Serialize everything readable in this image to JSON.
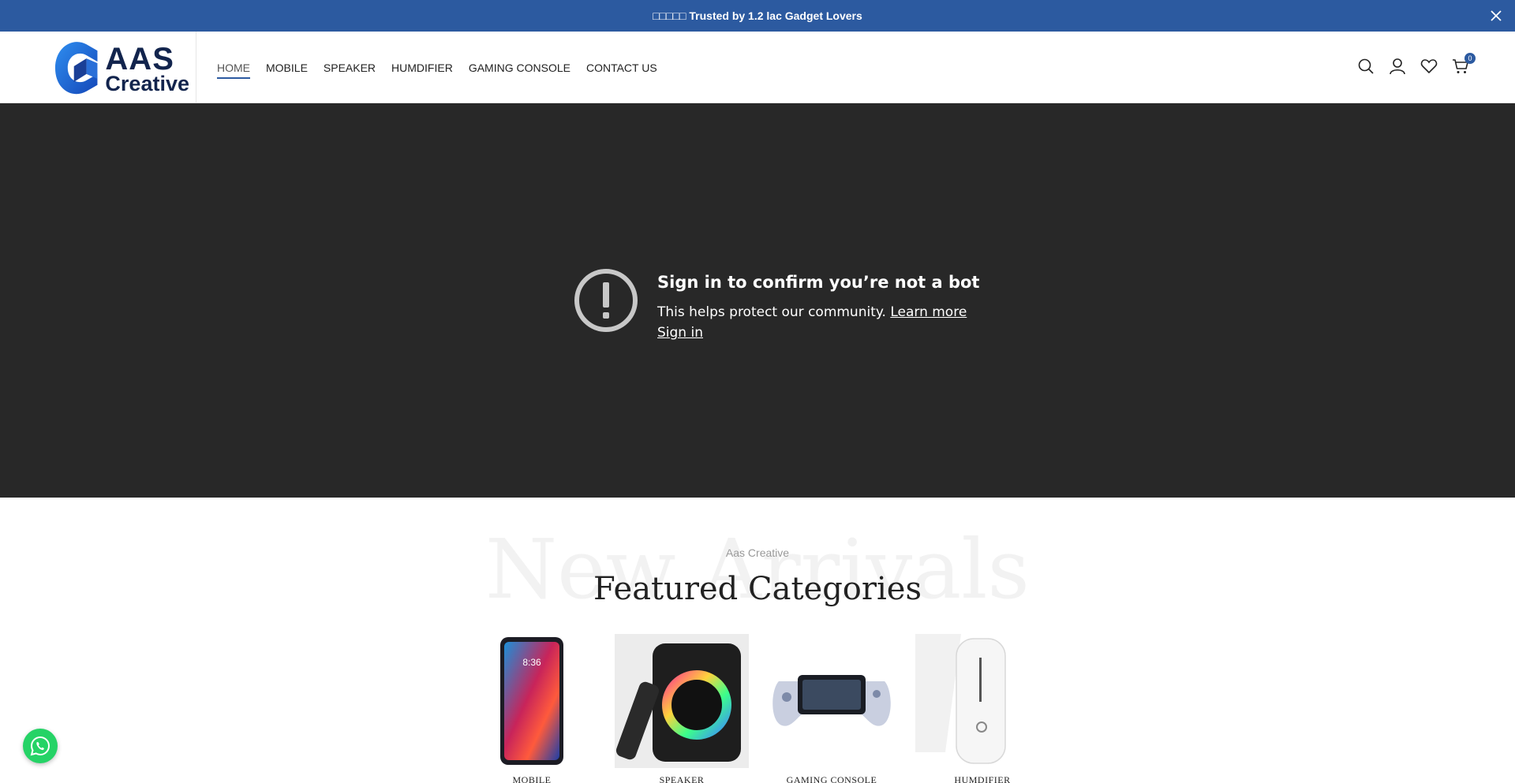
{
  "announcement": {
    "text": "□□□□□ Trusted by 1.2 lac Gadget Lovers"
  },
  "brand": {
    "line1": "AAS",
    "line2": "Creative",
    "accent": "#2c5aa0"
  },
  "nav": {
    "items": [
      {
        "label": "HOME"
      },
      {
        "label": "MOBILE"
      },
      {
        "label": "SPEAKER"
      },
      {
        "label": "HUMDIFIER"
      },
      {
        "label": "GAMING CONSOLE"
      },
      {
        "label": "CONTACT US"
      }
    ]
  },
  "header_icons": {
    "search": "search-icon",
    "account": "user-icon",
    "wishlist": "heart-icon",
    "cart": "cart-icon",
    "cart_count": "0"
  },
  "video": {
    "title": "Sign in to confirm you’re not a bot",
    "message": "This helps protect our community.",
    "learn_more": "Learn more",
    "sign_in": "Sign in"
  },
  "featured": {
    "subtitle": "Aas Creative",
    "background_word": "New Arrivals",
    "title": "Featured Categories",
    "categories": [
      {
        "label": "MOBILE"
      },
      {
        "label": "SPEAKER"
      },
      {
        "label": "GAMING CONSOLE"
      },
      {
        "label": "HUMDIFIER"
      }
    ]
  },
  "colors": {
    "topbar": "#2c5aa0",
    "video_bg": "#282828",
    "whatsapp": "#25d366"
  }
}
